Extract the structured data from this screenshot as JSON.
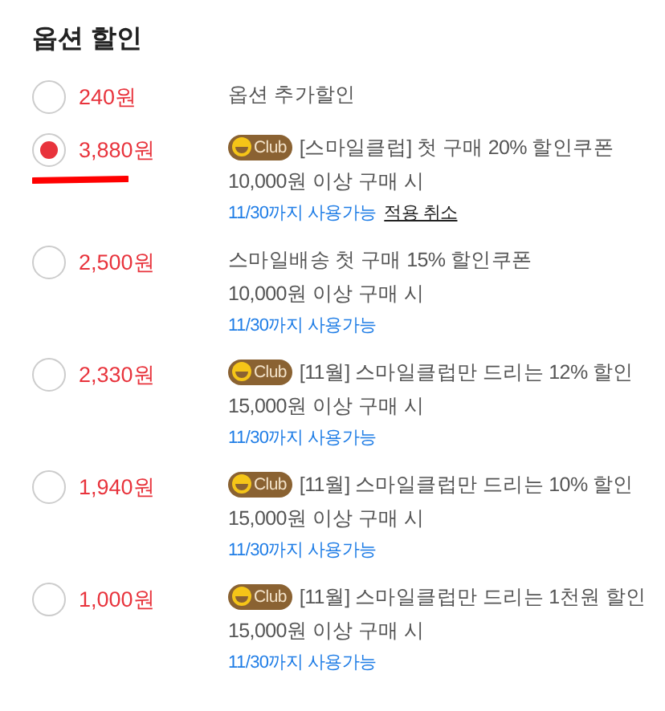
{
  "title": "옵션 할인",
  "options": [
    {
      "selected": false,
      "marked": false,
      "price": "240원",
      "name": "옵션 추가할인"
    },
    {
      "selected": true,
      "marked": true,
      "price": "3,880원",
      "badge": "Club",
      "name": "[스마일클럽] 첫 구매 20% 할인쿠폰",
      "condition": "10,000원 이상 구매 시",
      "valid": "11/30까지 사용가능",
      "cancel": "적용 취소"
    },
    {
      "selected": false,
      "marked": false,
      "price": "2,500원",
      "name": "스마일배송 첫 구매 15% 할인쿠폰",
      "condition": "10,000원 이상 구매 시",
      "valid": "11/30까지 사용가능"
    },
    {
      "selected": false,
      "marked": false,
      "price": "2,330원",
      "badge": "Club",
      "name": "[11월] 스마일클럽만 드리는 12% 할인",
      "condition": "15,000원 이상 구매 시",
      "valid": "11/30까지 사용가능"
    },
    {
      "selected": false,
      "marked": false,
      "price": "1,940원",
      "badge": "Club",
      "name": "[11월] 스마일클럽만 드리는 10% 할인",
      "condition": "15,000원 이상 구매 시",
      "valid": "11/30까지 사용가능"
    },
    {
      "selected": false,
      "marked": false,
      "price": "1,000원",
      "badge": "Club",
      "name": "[11월] 스마일클럽만 드리는 1천원 할인",
      "condition": "15,000원 이상 구매 시",
      "valid": "11/30까지 사용가능"
    }
  ]
}
